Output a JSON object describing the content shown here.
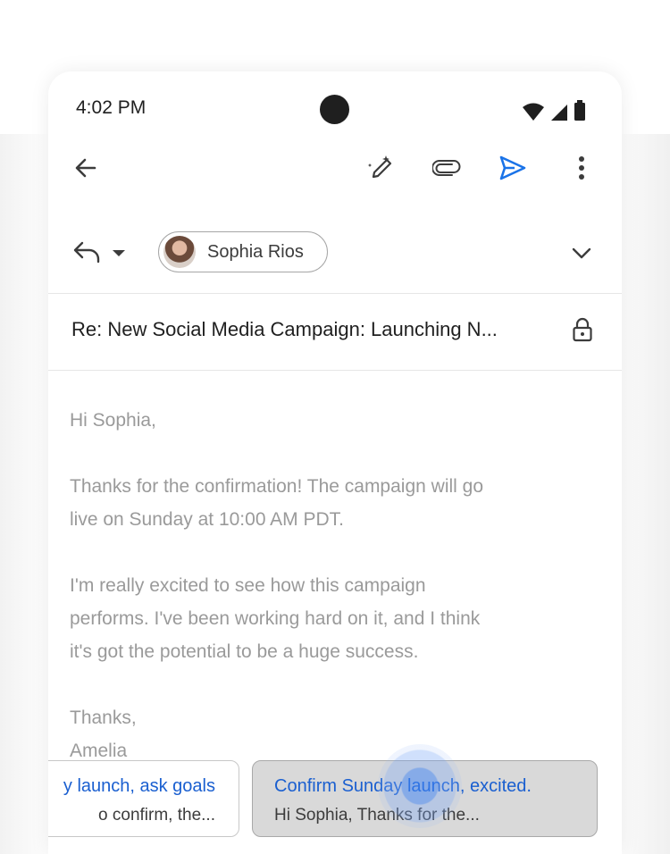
{
  "status_bar": {
    "time": "4:02 PM",
    "icons": [
      "wifi-icon",
      "cellular-signal-icon",
      "battery-icon"
    ]
  },
  "toolbar": {
    "icons": [
      "back-arrow-icon",
      "help-me-write-pencil-icon",
      "attach-paperclip-icon",
      "send-icon",
      "more-vert-icon"
    ],
    "send_color": "#1a73e8"
  },
  "recipients": {
    "reply_icon": "reply-icon",
    "reply_menu_icon": "dropdown-caret-icon",
    "chips": [
      {
        "name": "Sophia Rios",
        "avatar": "avatar"
      }
    ],
    "expand_icon": "chevron-down-icon"
  },
  "subject": {
    "text": "Re: New Social Media Campaign: Launching N...",
    "lock_icon": "lock-icon"
  },
  "body": {
    "greeting": "Hi Sophia,",
    "para1_line1": "Thanks for the confirmation! The campaign will go",
    "para1_line2": "live on Sunday at 10:00 AM PDT.",
    "para2_line1": "I'm really excited to see how this campaign",
    "para2_line2": "performs. I've been working hard on it, and I think",
    "para2_line3": "it's got the potential to be a huge success.",
    "signoff": "Thanks,",
    "signature": "Amelia"
  },
  "suggestions": [
    {
      "title": "y launch, ask goals",
      "preview": "o confirm, the..."
    },
    {
      "title": "Confirm Sunday launch, excited.",
      "preview": "Hi Sophia, Thanks for the..."
    }
  ],
  "colors": {
    "accent": "#1a73e8",
    "suggestion_title": "#1a5fd0",
    "selected_suggestion_bg": "#d9d9d9"
  }
}
